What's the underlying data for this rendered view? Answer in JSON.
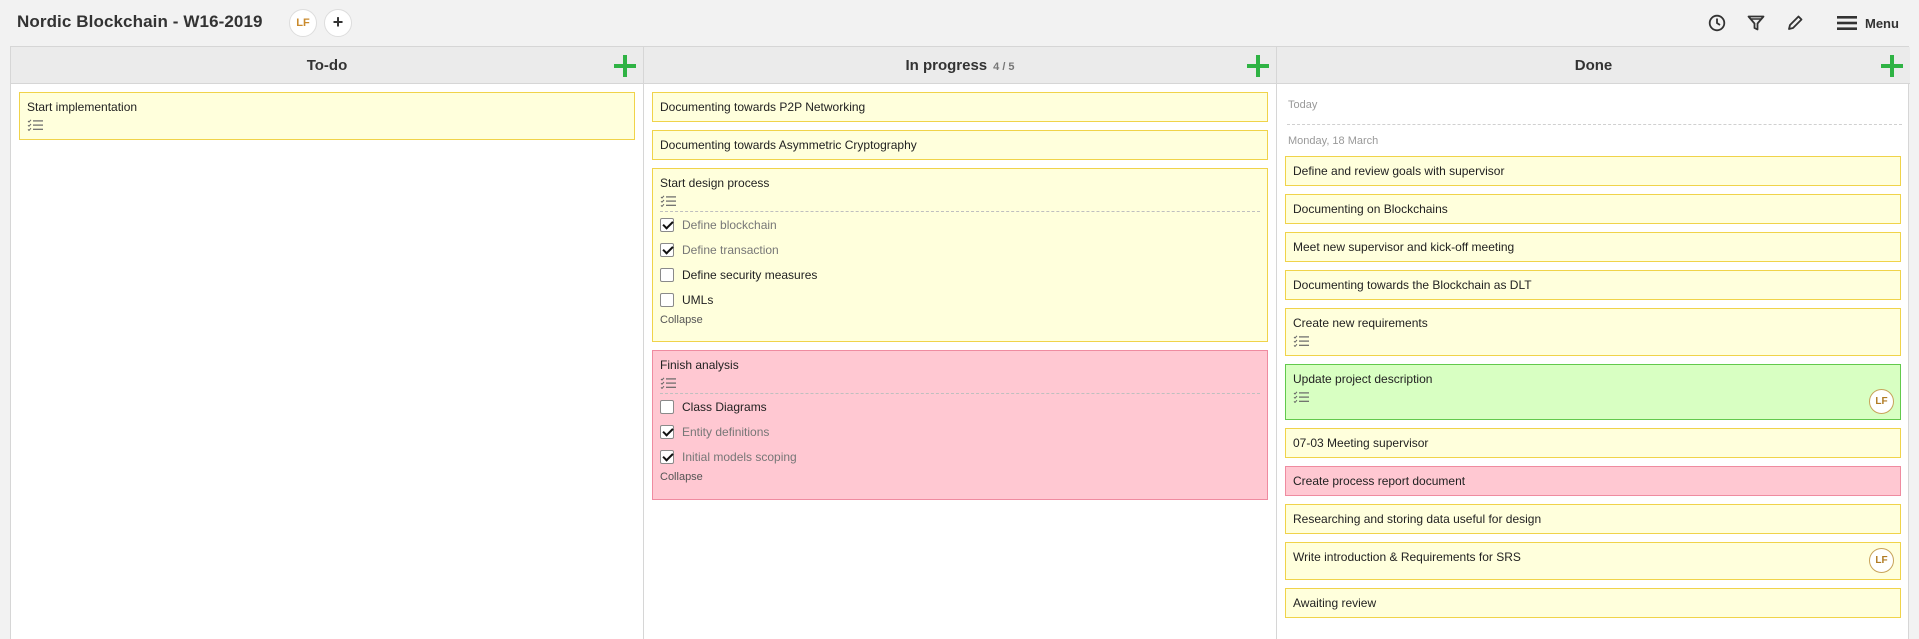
{
  "header": {
    "title": "Nordic Blockchain - W16-2019",
    "member_initials": "LF",
    "add_member_label": "+",
    "menu_label": "Menu"
  },
  "columns": {
    "todo": {
      "title": "To-do"
    },
    "progress": {
      "title": "In progress",
      "wip": "4 / 5"
    },
    "done": {
      "title": "Done",
      "today_label": "Today",
      "date_label": "Monday, 18 March"
    }
  },
  "todo_cards": [
    {
      "title": "Start implementation",
      "has_checklist": true
    }
  ],
  "progress_cards": {
    "c1": {
      "title": "Documenting towards P2P Networking"
    },
    "c2": {
      "title": "Documenting towards Asymmetric Cryptography"
    },
    "c3": {
      "title": "Start design process",
      "color": "yellow",
      "items": [
        {
          "label": "Define blockchain",
          "checked": true
        },
        {
          "label": "Define transaction",
          "checked": true
        },
        {
          "label": "Define security measures",
          "checked": false
        },
        {
          "label": "UMLs",
          "checked": false
        }
      ],
      "collapse": "Collapse"
    },
    "c4": {
      "title": "Finish analysis",
      "color": "pink",
      "items": [
        {
          "label": "Class Diagrams",
          "checked": false
        },
        {
          "label": "Entity definitions",
          "checked": true
        },
        {
          "label": "Initial models scoping",
          "checked": true
        }
      ],
      "collapse": "Collapse"
    }
  },
  "done_cards": [
    {
      "title": "Define and review goals with supervisor",
      "color": "yellow"
    },
    {
      "title": "Documenting on Blockchains",
      "color": "yellow"
    },
    {
      "title": "Meet new supervisor and kick-off meeting",
      "color": "yellow"
    },
    {
      "title": "Documenting towards the Blockchain as DLT",
      "color": "yellow"
    },
    {
      "title": "Create new requirements",
      "color": "yellow",
      "has_checklist": true
    },
    {
      "title": "Update project description",
      "color": "green",
      "has_checklist": true,
      "assignee": "LF"
    },
    {
      "title": "07-03 Meeting supervisor",
      "color": "yellow"
    },
    {
      "title": "Create process report document",
      "color": "pink"
    },
    {
      "title": "Researching and storing data useful for design",
      "color": "yellow"
    },
    {
      "title": "Write introduction & Requirements for SRS",
      "color": "yellow",
      "assignee": "LF"
    },
    {
      "title": "Awaiting review",
      "color": "yellow"
    }
  ],
  "icons": {
    "history": "clock-icon",
    "filter": "filter-icon",
    "edit": "pencil-icon",
    "menu": "hamburger-icon",
    "checklist": "checklist-icon",
    "add": "plus-icon"
  },
  "colors": {
    "card_yellow": "#ffffdc",
    "card_pink": "#ffc8d2",
    "card_green": "#d8ffc2",
    "add_green": "#2fb344"
  }
}
